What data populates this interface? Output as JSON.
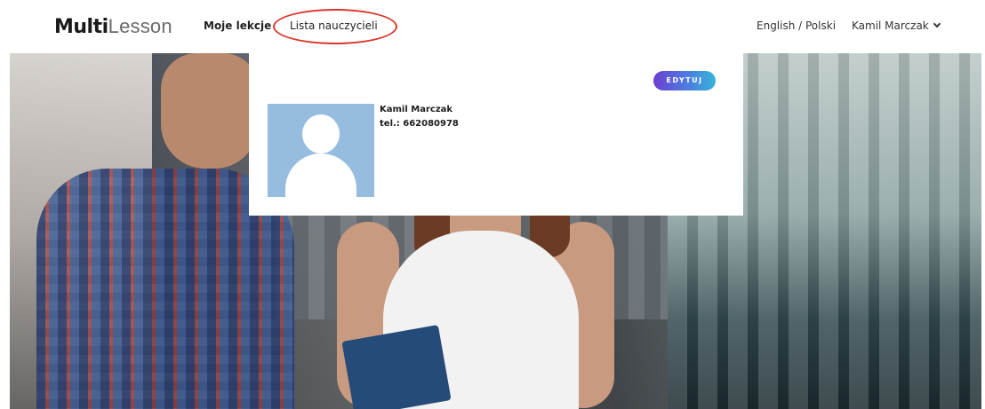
{
  "header": {
    "logo_bold": "Multi",
    "logo_light": "Lesson",
    "nav": [
      {
        "label": "Moje lekcje"
      },
      {
        "label": "Lista nauczycieli"
      }
    ],
    "language": "English / Polski",
    "user_name": "Kamil Marczak",
    "highlight_color": "#d9362b"
  },
  "profile": {
    "name": "Kamil Marczak",
    "phone": "tel.: 662080978",
    "edit_label": "EDYTUJ",
    "avatar_color": "#96bddf"
  },
  "icons": {
    "user_menu": "chevron-down-icon",
    "avatar": "user-silhouette-icon"
  }
}
